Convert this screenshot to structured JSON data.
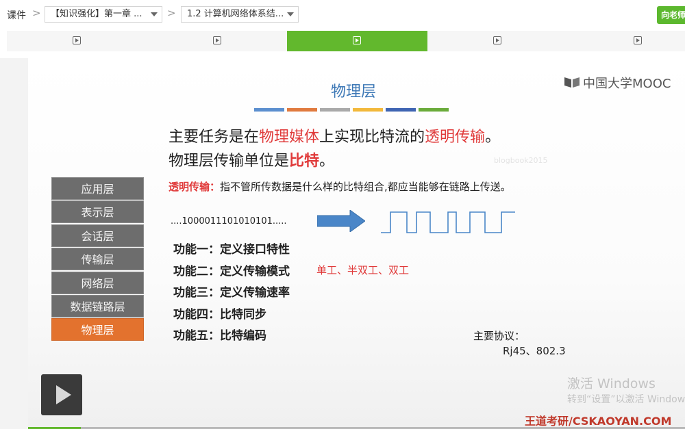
{
  "breadcrumb": {
    "root": "课件",
    "separator": ">",
    "chapter": "【知识强化】第一章 ...",
    "lesson": "1.2 计算机网络体系结..."
  },
  "teacher_button": "向老师",
  "units": {
    "count": 5,
    "active_index": 2
  },
  "slide": {
    "title": "物理层",
    "title_bar_colors": [
      "#5b8fcf",
      "#e07a3e",
      "#a9a9a9",
      "#f2b83b",
      "#3e64b2",
      "#6aab3a"
    ],
    "logo": "中国大学MOOC",
    "task": {
      "prefix": "主要任务是在",
      "medium": "物理媒体",
      "mid": "上实现比特流的",
      "transparent": "透明传输",
      "suffix": "。"
    },
    "unit": {
      "prefix": "物理层传输单位是",
      "bit": "比特",
      "suffix": "。"
    },
    "faint_text": "blogbook2015",
    "transparent_def": {
      "label": "透明传输：",
      "text": "指不管所传数据是什么样的比特组合,都应当能够在链路上传送。"
    },
    "layers": [
      "应用层",
      "表示层",
      "会话层",
      "传输层",
      "网络层",
      "数据链路层",
      "物理层"
    ],
    "highlight_layer": 6,
    "bit_stream": "....1000011101010101.....",
    "functions": [
      "功能一：定义接口特性",
      "功能二：定义传输模式",
      "功能三：定义传输速率",
      "功能四：比特同步",
      "功能五：比特编码"
    ],
    "mode_examples": "单工、半双工、双工",
    "protocol_label": "主要协议：",
    "protocol_value": "Rj45、802.3",
    "watermark": "王道考研/CSKAOYAN.COM"
  },
  "activation": {
    "line1": "激活 Windows",
    "line2": "转到“设置”以激活 Windows。"
  },
  "colors": {
    "accent_green": "#5cb82e",
    "title_blue": "#3d78b6",
    "highlight_red": "#e03a3a",
    "layer_highlight": "#e3722e",
    "layer_gray": "#6d6d6d"
  },
  "progress": {
    "played_fraction": 0.08
  }
}
